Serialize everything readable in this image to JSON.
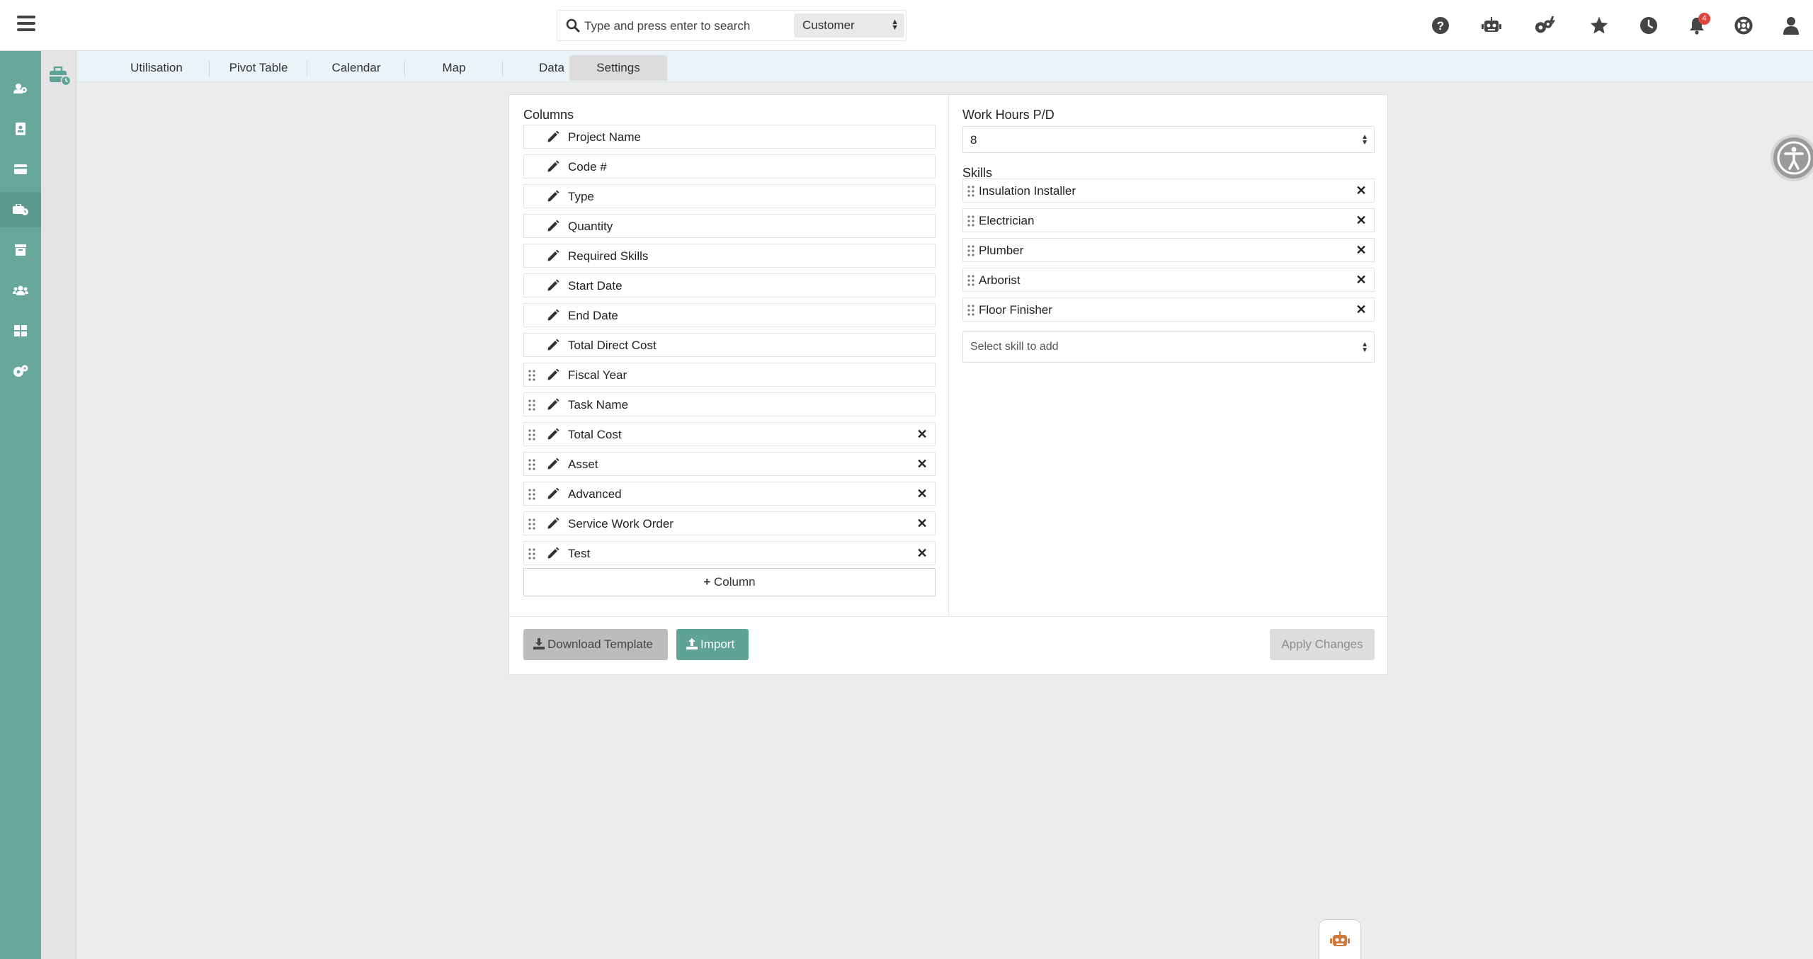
{
  "search": {
    "placeholder": "Type and press enter to search",
    "scope": "Customer"
  },
  "notifications": {
    "count": "4"
  },
  "tabs": [
    {
      "label": "Utilisation"
    },
    {
      "label": "Pivot Table"
    },
    {
      "label": "Calendar"
    },
    {
      "label": "Map"
    },
    {
      "label": "Data"
    },
    {
      "label": "Settings"
    }
  ],
  "columns": {
    "title": "Columns",
    "items": [
      {
        "label": "Project Name"
      },
      {
        "label": "Code #"
      },
      {
        "label": "Type"
      },
      {
        "label": "Quantity"
      },
      {
        "label": "Required Skills"
      },
      {
        "label": "Start Date"
      },
      {
        "label": "End Date"
      },
      {
        "label": "Total Direct Cost"
      },
      {
        "label": "Fiscal Year"
      },
      {
        "label": "Task Name"
      },
      {
        "label": "Total Cost"
      },
      {
        "label": "Asset"
      },
      {
        "label": "Advanced"
      },
      {
        "label": "Service Work Order"
      },
      {
        "label": "Test"
      }
    ],
    "add_label": "Column"
  },
  "work_hours": {
    "title": "Work Hours P/D",
    "value": "8"
  },
  "skills": {
    "title": "Skills",
    "items": [
      {
        "label": "Insulation Installer"
      },
      {
        "label": "Electrician"
      },
      {
        "label": "Plumber"
      },
      {
        "label": "Arborist"
      },
      {
        "label": "Floor Finisher"
      }
    ],
    "select_placeholder": "Select skill to add"
  },
  "footer": {
    "download_label": "Download Template",
    "import_label": "Import",
    "apply_label": "Apply Changes"
  },
  "colors": {
    "accent": "#5ea396",
    "sidebar": "#67a89a",
    "badge": "#e0443d"
  }
}
